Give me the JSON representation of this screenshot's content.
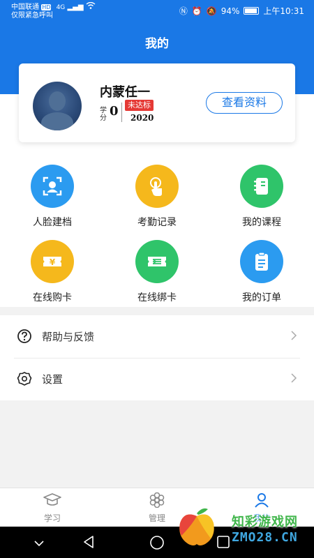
{
  "status_bar": {
    "carrier_line1": "中国联通",
    "carrier_hd": "HD",
    "carrier_line2": "仅限紧急呼叫",
    "signal": "4G",
    "battery": "94%",
    "time": "上午10:31"
  },
  "header": {
    "title": "我的"
  },
  "profile": {
    "name": "内蒙任一",
    "credit_label": "学分",
    "credit_value": "0",
    "badge": "未达标",
    "year": "2020",
    "view_button": "查看资料"
  },
  "grid": [
    {
      "label": "人脸建档",
      "icon": "face-scan-icon",
      "color": "#2b9bf0"
    },
    {
      "label": "考勤记录",
      "icon": "touch-click-icon",
      "color": "#f5b81c"
    },
    {
      "label": "我的课程",
      "icon": "notebook-icon",
      "color": "#2fc46a"
    },
    {
      "label": "在线购卡",
      "icon": "ticket-yen-icon",
      "color": "#f5b81c"
    },
    {
      "label": "在线绑卡",
      "icon": "ticket-bind-icon",
      "color": "#2fc46a"
    },
    {
      "label": "我的订单",
      "icon": "clipboard-icon",
      "color": "#2b9bf0"
    }
  ],
  "menu": [
    {
      "label": "帮助与反馈",
      "icon": "help-icon"
    },
    {
      "label": "设置",
      "icon": "settings-gear-icon"
    }
  ],
  "tabs": [
    {
      "label": "学习",
      "icon": "graduation-cap-icon"
    },
    {
      "label": "管理",
      "icon": "flower-icon"
    },
    {
      "label": "我的",
      "icon": "person-icon"
    }
  ],
  "watermark": {
    "line1": "知彩游戏网",
    "line2": "ZMO28.CN"
  },
  "colors": {
    "primary": "#1a78e6",
    "badge": "#e53935"
  }
}
